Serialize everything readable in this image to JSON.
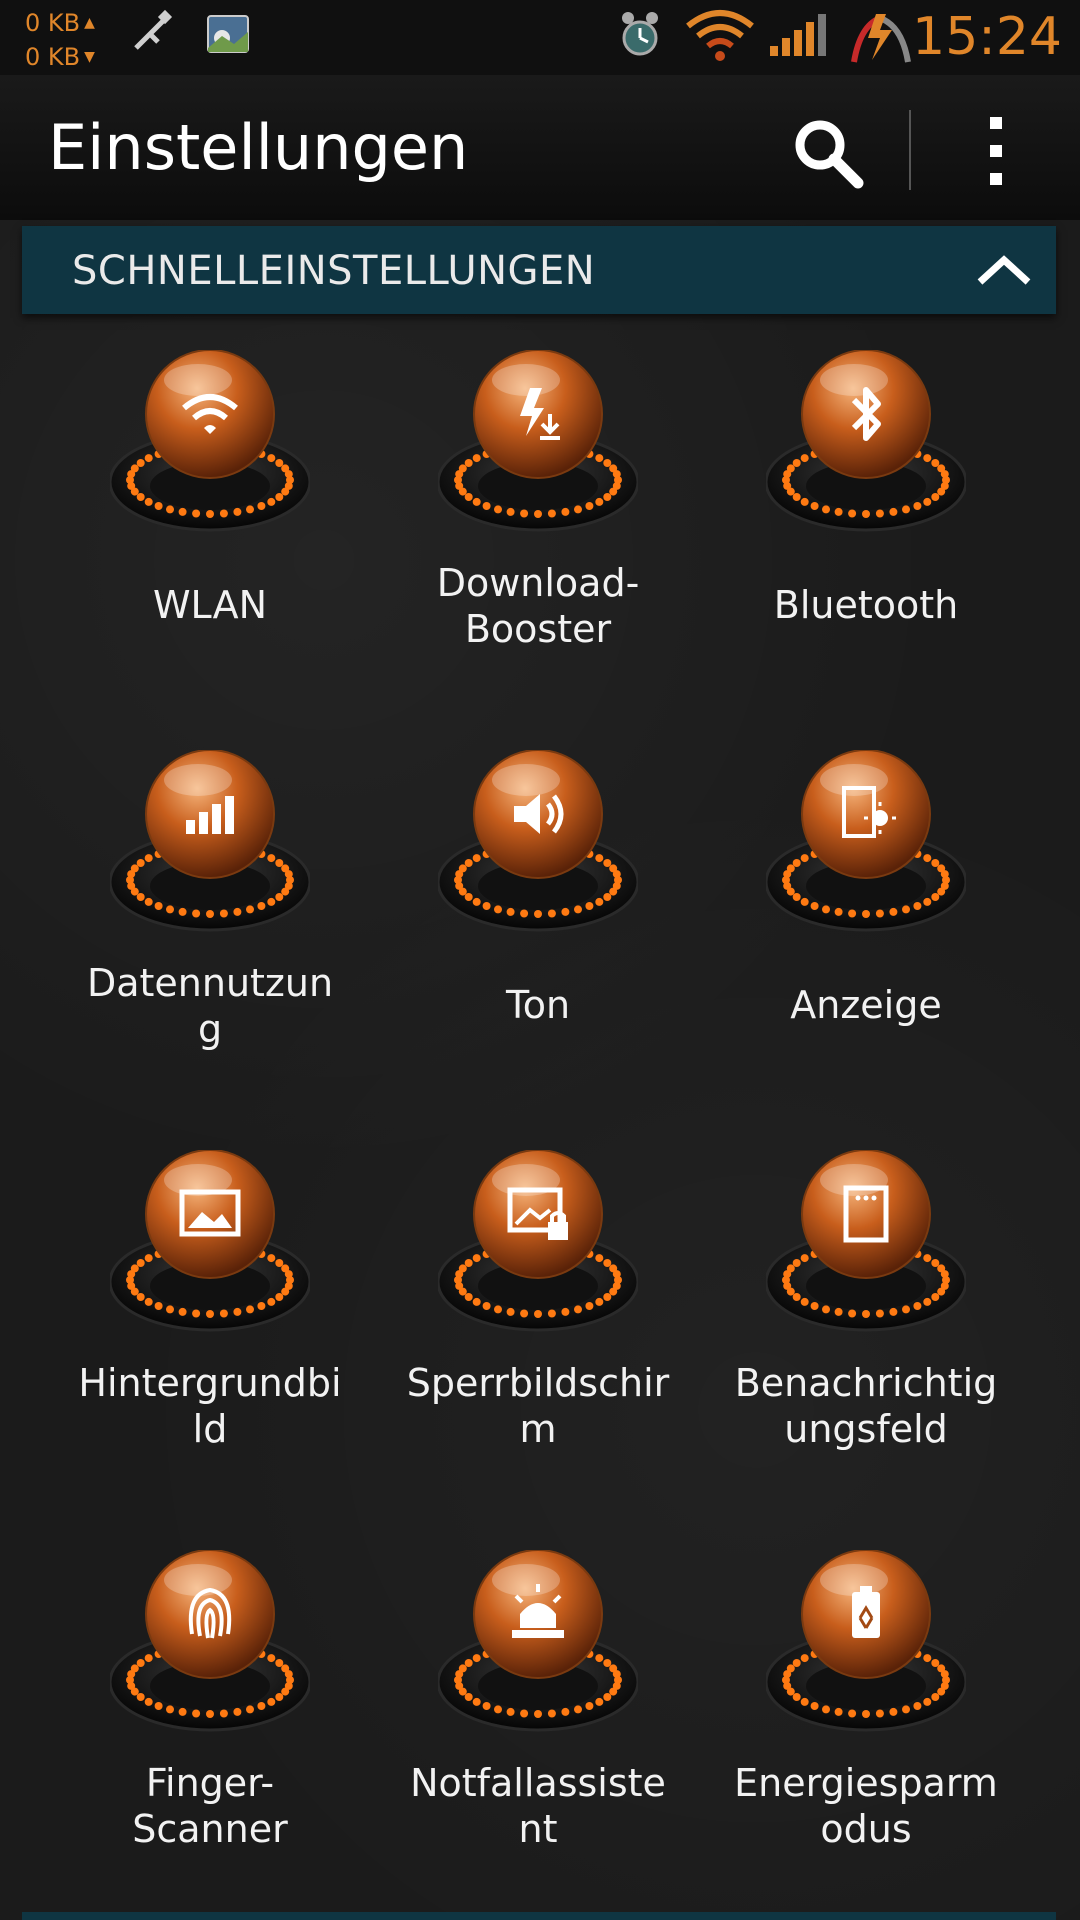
{
  "status_bar": {
    "net_up": "0 KB",
    "net_down": "0 KB",
    "time": "15:24",
    "accent_color": "#e0862a"
  },
  "app_bar": {
    "title": "Einstellungen",
    "search_icon": "search-icon",
    "menu_icon": "overflow-menu-icon"
  },
  "section": {
    "title": "SCHNELLEINSTELLUNGEN",
    "toggle_icon": "chevron-up-icon",
    "header_color": "#0f3542"
  },
  "tiles": [
    {
      "label_lines": [
        "WLAN"
      ],
      "icon": "wifi-icon"
    },
    {
      "label_lines": [
        "Download-",
        "Booster"
      ],
      "icon": "download-booster-icon"
    },
    {
      "label_lines": [
        "Bluetooth"
      ],
      "icon": "bluetooth-icon"
    },
    {
      "label_lines": [
        "Datennutzun",
        "g"
      ],
      "icon": "data-usage-icon"
    },
    {
      "label_lines": [
        "Ton"
      ],
      "icon": "sound-icon"
    },
    {
      "label_lines": [
        "Anzeige"
      ],
      "icon": "display-icon"
    },
    {
      "label_lines": [
        "Hintergrundbi",
        "ld"
      ],
      "icon": "wallpaper-icon"
    },
    {
      "label_lines": [
        "Sperrbildschir",
        "m"
      ],
      "icon": "lock-screen-icon"
    },
    {
      "label_lines": [
        "Benachrichtig",
        "ungsfeld"
      ],
      "icon": "notification-panel-icon"
    },
    {
      "label_lines": [
        "Finger-",
        "Scanner"
      ],
      "icon": "fingerprint-icon"
    },
    {
      "label_lines": [
        "Notfallassiste",
        "nt"
      ],
      "icon": "emergency-icon"
    },
    {
      "label_lines": [
        "Energiesparm",
        "odus"
      ],
      "icon": "power-saving-icon"
    }
  ]
}
